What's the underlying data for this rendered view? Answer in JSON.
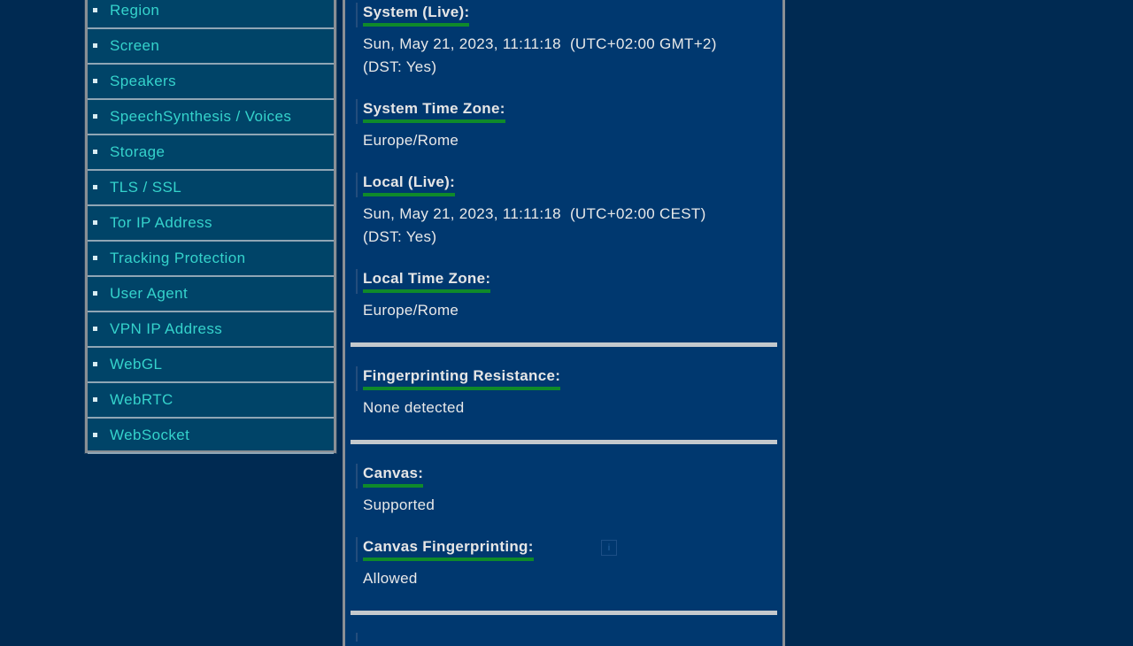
{
  "sidebar": {
    "items": [
      {
        "label": "Region"
      },
      {
        "label": "Screen"
      },
      {
        "label": "Speakers"
      },
      {
        "label": "SpeechSynthesis / Voices"
      },
      {
        "label": "Storage"
      },
      {
        "label": "TLS / SSL"
      },
      {
        "label": "Tor IP Address"
      },
      {
        "label": "Tracking Protection"
      },
      {
        "label": "User Agent"
      },
      {
        "label": "VPN IP Address"
      },
      {
        "label": "WebGL"
      },
      {
        "label": "WebRTC"
      },
      {
        "label": "WebSocket"
      }
    ]
  },
  "main": {
    "system_live": {
      "label": "System (Live):",
      "value_line1": "Sun, May 21, 2023, 11:11:18  (UTC+02:00 GMT+2)",
      "value_line2": "(DST: Yes)"
    },
    "system_tz": {
      "label": "System Time Zone:",
      "value": "Europe/Rome"
    },
    "local_live": {
      "label": "Local (Live):",
      "value_line1": "Sun, May 21, 2023, 11:11:18  (UTC+02:00 CEST)",
      "value_line2": "(DST: Yes)"
    },
    "local_tz": {
      "label": "Local Time Zone:",
      "value": "Europe/Rome"
    },
    "fingerprinting": {
      "label": "Fingerprinting Resistance:",
      "value": "None detected"
    },
    "canvas": {
      "label": "Canvas:",
      "value": "Supported"
    },
    "canvas_fp": {
      "label": "Canvas Fingerprinting:",
      "value": "Allowed",
      "info_icon": "i"
    }
  },
  "colors": {
    "page_bg": "#002a52",
    "sidebar_bg": "#004468",
    "nav_text": "#35d3cc",
    "main_bg": "#00386f",
    "label_underline": "#0f8a2a",
    "divider": "#c4c9cd"
  }
}
